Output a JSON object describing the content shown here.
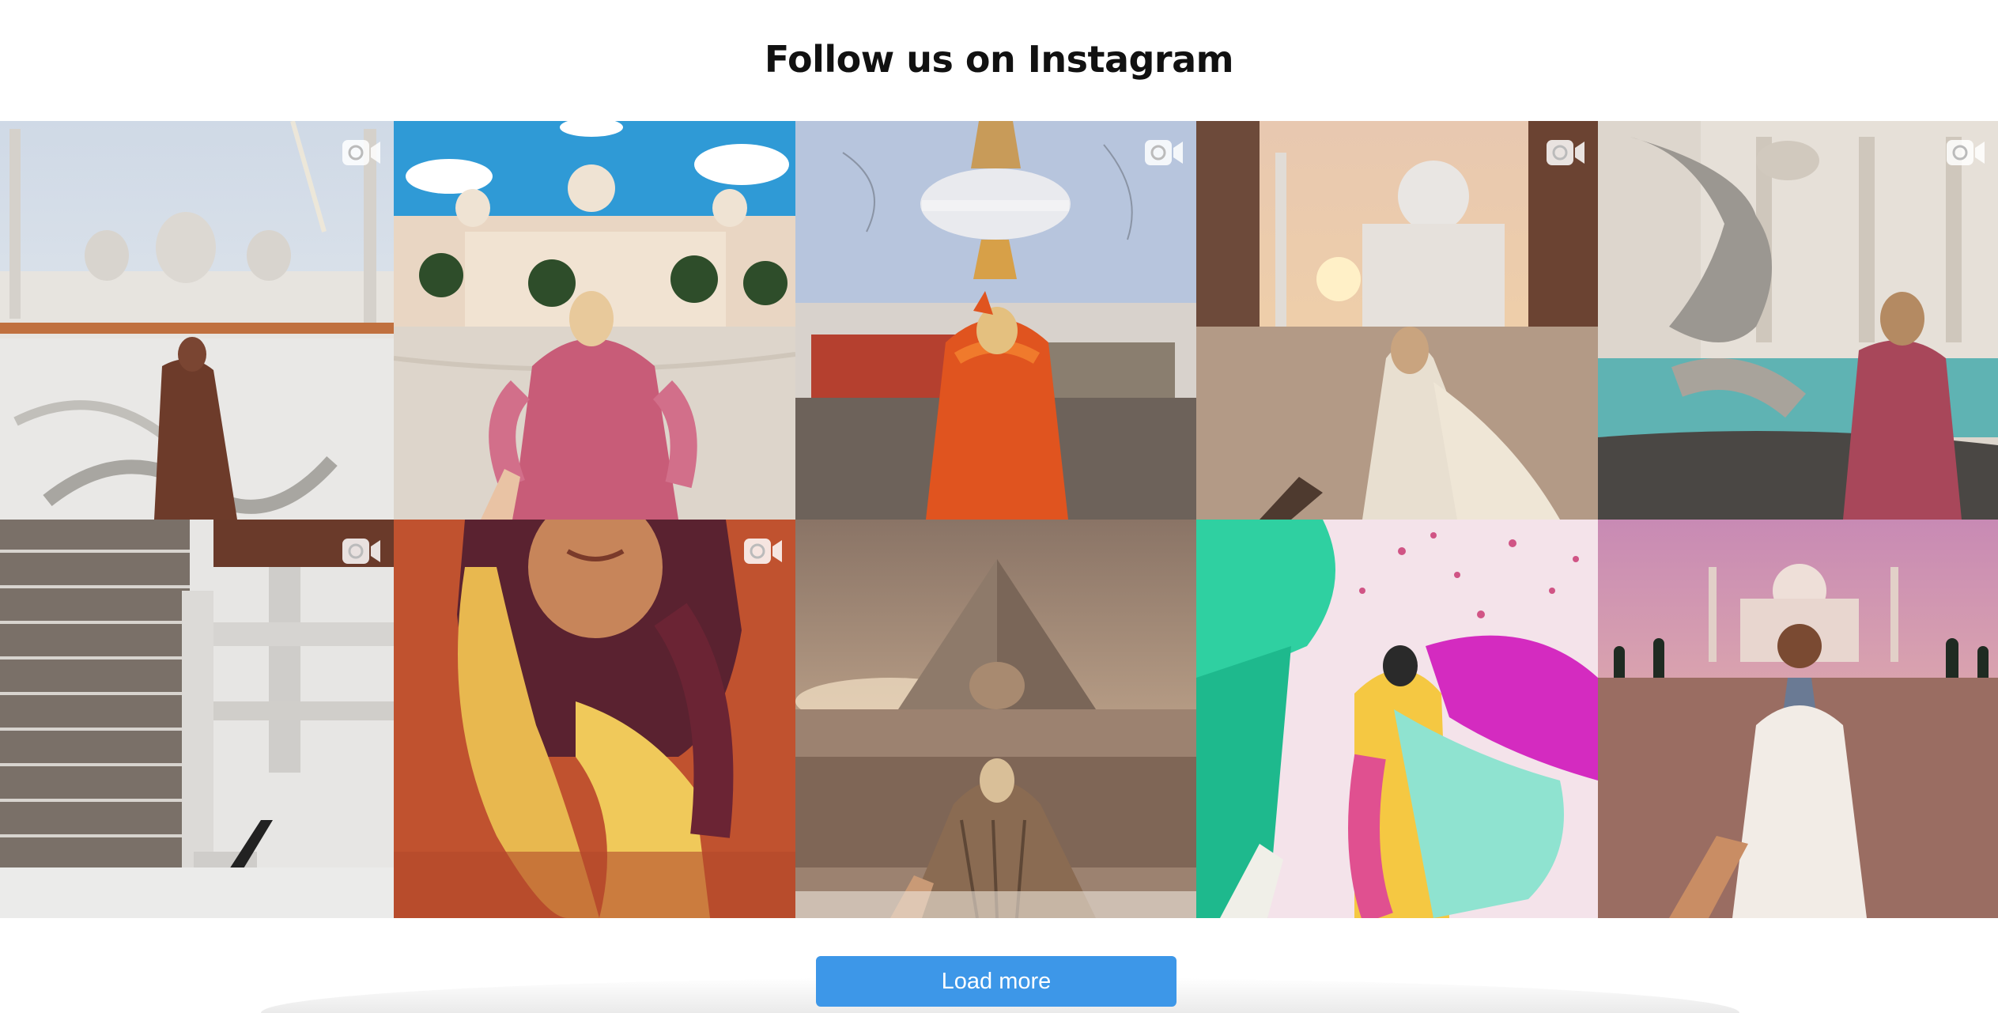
{
  "section": {
    "title": "Follow us on Instagram"
  },
  "grid": {
    "tiles": [
      {
        "subject": "Woman in brown robe before white domed mosque",
        "has_video": true
      },
      {
        "subject": "Woman in pink pleated dress before palace with palm trees",
        "has_video": false
      },
      {
        "subject": "Woman in orange dress before Buddhist stupa",
        "has_video": true
      },
      {
        "subject": "Woman in white gown at Taj Mahal doorway at sunset",
        "has_video": true
      },
      {
        "subject": "Woman by Trevi fountain winged horse statue",
        "has_video": true
      },
      {
        "subject": "Library interior with tall bookshelves",
        "has_video": true
      },
      {
        "subject": "Woman wearing yellow and maroon headscarf",
        "has_video": true
      },
      {
        "subject": "Woman in cape before Great Pyramid and Sphinx",
        "has_video": false
      },
      {
        "subject": "Woman in colorful dress during Holi color festival",
        "has_video": false
      },
      {
        "subject": "Woman in lace dress before Taj Mahal at dusk",
        "has_video": false
      }
    ]
  },
  "actions": {
    "load_more_label": "Load more"
  },
  "colors": {
    "button": "#3d97e8",
    "title_text": "#111111"
  }
}
